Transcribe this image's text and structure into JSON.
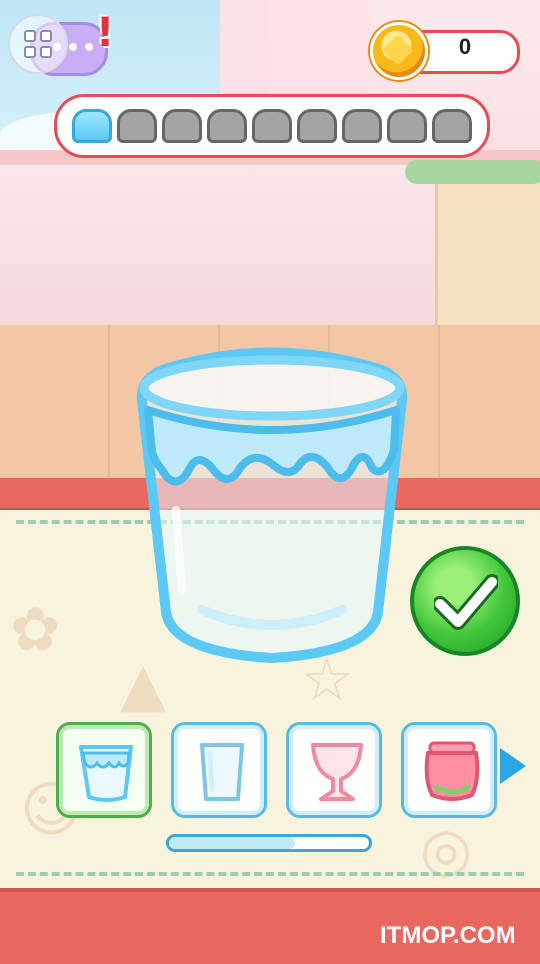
{
  "coins": {
    "value": "0"
  },
  "progress": {
    "total_steps": 9,
    "current_step": 1
  },
  "cup_selector": {
    "items": [
      {
        "icon": "dripping-glass-icon",
        "selected": true
      },
      {
        "icon": "tall-glass-icon",
        "selected": false
      },
      {
        "icon": "sundae-glass-icon",
        "selected": false
      },
      {
        "icon": "strawberry-jar-icon",
        "selected": false
      }
    ],
    "scroll_position": 0.63
  },
  "watermark": "ITMOP.COM",
  "colors": {
    "accent_red": "#e94b55",
    "glass_blue": "#5cc9f5",
    "confirm_green": "#43c63a",
    "selected_green": "#4bb04a"
  }
}
